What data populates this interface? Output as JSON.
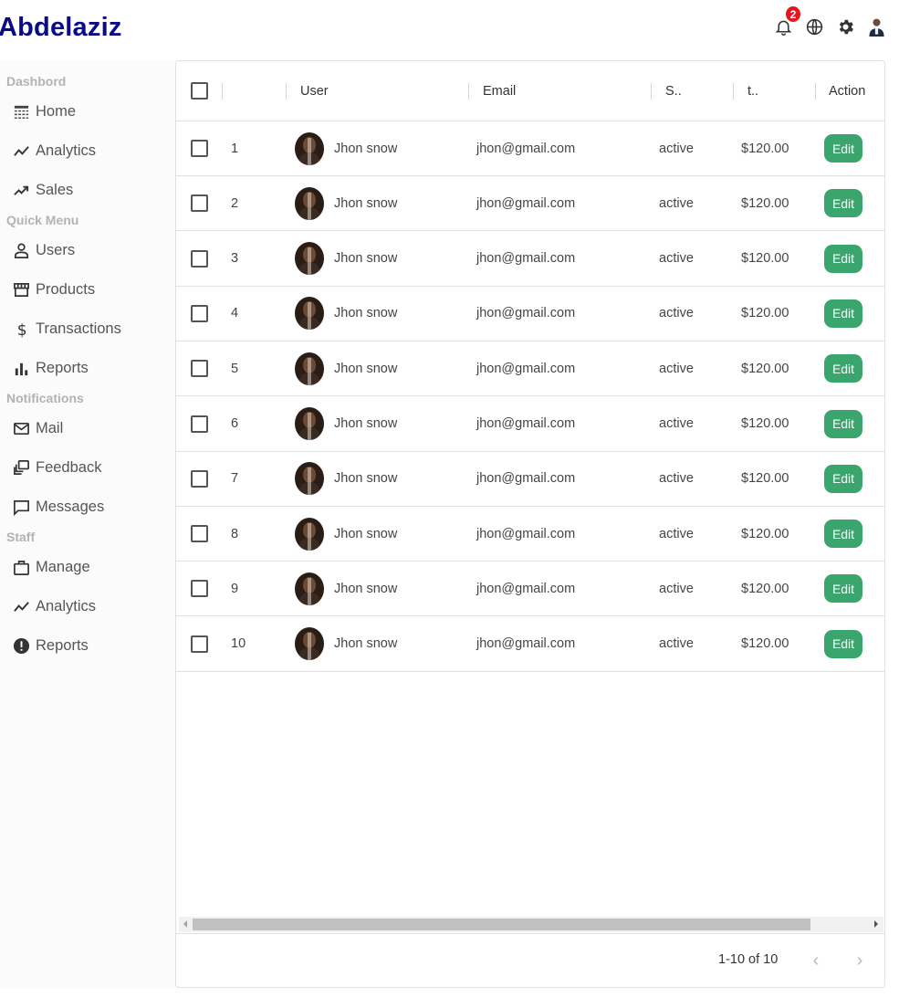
{
  "app": {
    "logo": "Abdelaziz"
  },
  "topbar": {
    "icons": [
      "bell-icon",
      "globe-icon",
      "gear-icon",
      "user-avatar"
    ],
    "notification_count": "2"
  },
  "sidebar": {
    "sections": [
      {
        "title": "Dashbord",
        "items": [
          {
            "label": "Home",
            "icon": "home-icon"
          },
          {
            "label": "Analytics",
            "icon": "line-chart-icon"
          },
          {
            "label": "Sales",
            "icon": "trending-up-icon"
          }
        ]
      },
      {
        "title": "Quick Menu",
        "items": [
          {
            "label": "Users",
            "icon": "user-icon"
          },
          {
            "label": "Products",
            "icon": "store-icon"
          },
          {
            "label": "Transactions",
            "icon": "dollar-icon"
          },
          {
            "label": "Reports",
            "icon": "bar-chart-icon"
          }
        ]
      },
      {
        "title": "Notifications",
        "items": [
          {
            "label": "Mail",
            "icon": "mail-icon"
          },
          {
            "label": "Feedback",
            "icon": "feedback-icon"
          },
          {
            "label": "Messages",
            "icon": "message-icon"
          }
        ]
      },
      {
        "title": "Staff",
        "items": [
          {
            "label": "Manage",
            "icon": "briefcase-icon"
          },
          {
            "label": "Analytics",
            "icon": "line-chart-icon"
          },
          {
            "label": "Reports",
            "icon": "alert-circle-icon"
          }
        ]
      }
    ]
  },
  "table": {
    "columns": [
      "",
      "User",
      "Email",
      "S..",
      "t..",
      "Action"
    ],
    "rows": [
      {
        "id": "1",
        "user": "Jhon snow",
        "email": "jhon@gmail.com",
        "status": "active",
        "amount": "$120.00",
        "action": "Edit"
      },
      {
        "id": "2",
        "user": "Jhon snow",
        "email": "jhon@gmail.com",
        "status": "active",
        "amount": "$120.00",
        "action": "Edit"
      },
      {
        "id": "3",
        "user": "Jhon snow",
        "email": "jhon@gmail.com",
        "status": "active",
        "amount": "$120.00",
        "action": "Edit"
      },
      {
        "id": "4",
        "user": "Jhon snow",
        "email": "jhon@gmail.com",
        "status": "active",
        "amount": "$120.00",
        "action": "Edit"
      },
      {
        "id": "5",
        "user": "Jhon snow",
        "email": "jhon@gmail.com",
        "status": "active",
        "amount": "$120.00",
        "action": "Edit"
      },
      {
        "id": "6",
        "user": "Jhon snow",
        "email": "jhon@gmail.com",
        "status": "active",
        "amount": "$120.00",
        "action": "Edit"
      },
      {
        "id": "7",
        "user": "Jhon snow",
        "email": "jhon@gmail.com",
        "status": "active",
        "amount": "$120.00",
        "action": "Edit"
      },
      {
        "id": "8",
        "user": "Jhon snow",
        "email": "jhon@gmail.com",
        "status": "active",
        "amount": "$120.00",
        "action": "Edit"
      },
      {
        "id": "9",
        "user": "Jhon snow",
        "email": "jhon@gmail.com",
        "status": "active",
        "amount": "$120.00",
        "action": "Edit"
      },
      {
        "id": "10",
        "user": "Jhon snow",
        "email": "jhon@gmail.com",
        "status": "active",
        "amount": "$120.00",
        "action": "Edit"
      }
    ],
    "pagination": {
      "text": "1-10 of 10",
      "prev_icon": "chevron-left-icon",
      "next_icon": "chevron-right-icon"
    }
  },
  "colors": {
    "logo": "#0b0b8a",
    "edit_button": "#3aa56c",
    "badge": "#e8141e",
    "section_title": "#b3b3b3"
  }
}
